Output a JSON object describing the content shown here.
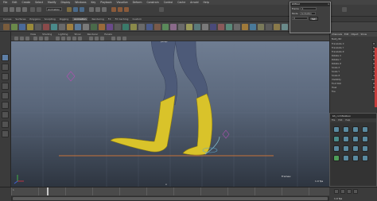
{
  "menu": [
    "File",
    "Edit",
    "Create",
    "Select",
    "Modify",
    "Display",
    "Windows",
    "Key",
    "Playback",
    "Visualize",
    "Deform",
    "Constrain",
    "Control",
    "Cache",
    "Arnold",
    "Help"
  ],
  "mode_dropdown": "Animation",
  "shelf_tabs": [
    "Curves",
    "Surfaces",
    "Polygons",
    "Sculpting",
    "Rigging",
    "Animation",
    "Rendering",
    "FX",
    "FX Caching",
    "Custom"
  ],
  "active_shelf_tab": "Animation",
  "panel_menu": [
    "View",
    "Shading",
    "Lighting",
    "Show",
    "Renderer",
    "Panels"
  ],
  "viewport": {
    "camera_label": "persp",
    "frames_label": "Frames:",
    "frames_value": "",
    "fps": "1.0 fps",
    "center_mark": "x"
  },
  "channel_box": {
    "tabs": [
      "Channels",
      "Edit",
      "Object",
      "Show"
    ],
    "object": "foot_ctrl",
    "attributes": [
      {
        "name": "Translate X",
        "value": "0"
      },
      {
        "name": "Translate Y",
        "value": "0"
      },
      {
        "name": "Translate Z",
        "value": "0"
      },
      {
        "name": "Rotate X",
        "value": "0"
      },
      {
        "name": "Rotate Y",
        "value": "0"
      },
      {
        "name": "Rotate Z",
        "value": "0"
      },
      {
        "name": "Scale X",
        "value": "1"
      },
      {
        "name": "Scale Y",
        "value": "1"
      },
      {
        "name": "Scale Z",
        "value": "1"
      },
      {
        "name": "Visibility",
        "value": "on"
      },
      {
        "name": "Foot Roll",
        "value": "0"
      },
      {
        "name": "Heel",
        "value": "0"
      },
      {
        "name": "Toe",
        "value": "0"
      }
    ]
  },
  "layers": {
    "label": "Layers"
  },
  "picker": {
    "title": "bh_ccmToolbox",
    "menu": [
      "File",
      "Edit",
      "Help"
    ]
  },
  "float_window": {
    "title": "bhTool",
    "close": "x",
    "row1_label": "Frame",
    "row1_value": "1",
    "row2_label": "Mode",
    "row2_value": "Animation",
    "button": "Set",
    "row3_value": "0"
  },
  "timeline": {
    "ticks": [
      "1",
      "",
      "",
      "",
      "",
      "",
      "",
      "",
      "",
      "",
      "",
      ""
    ],
    "fps": "1.0 fps"
  },
  "colors": {
    "boot": "#d9c32a",
    "leg": "#4d5a78",
    "ground_line": "#c8733a",
    "motion_path": "#7fb8c8"
  }
}
